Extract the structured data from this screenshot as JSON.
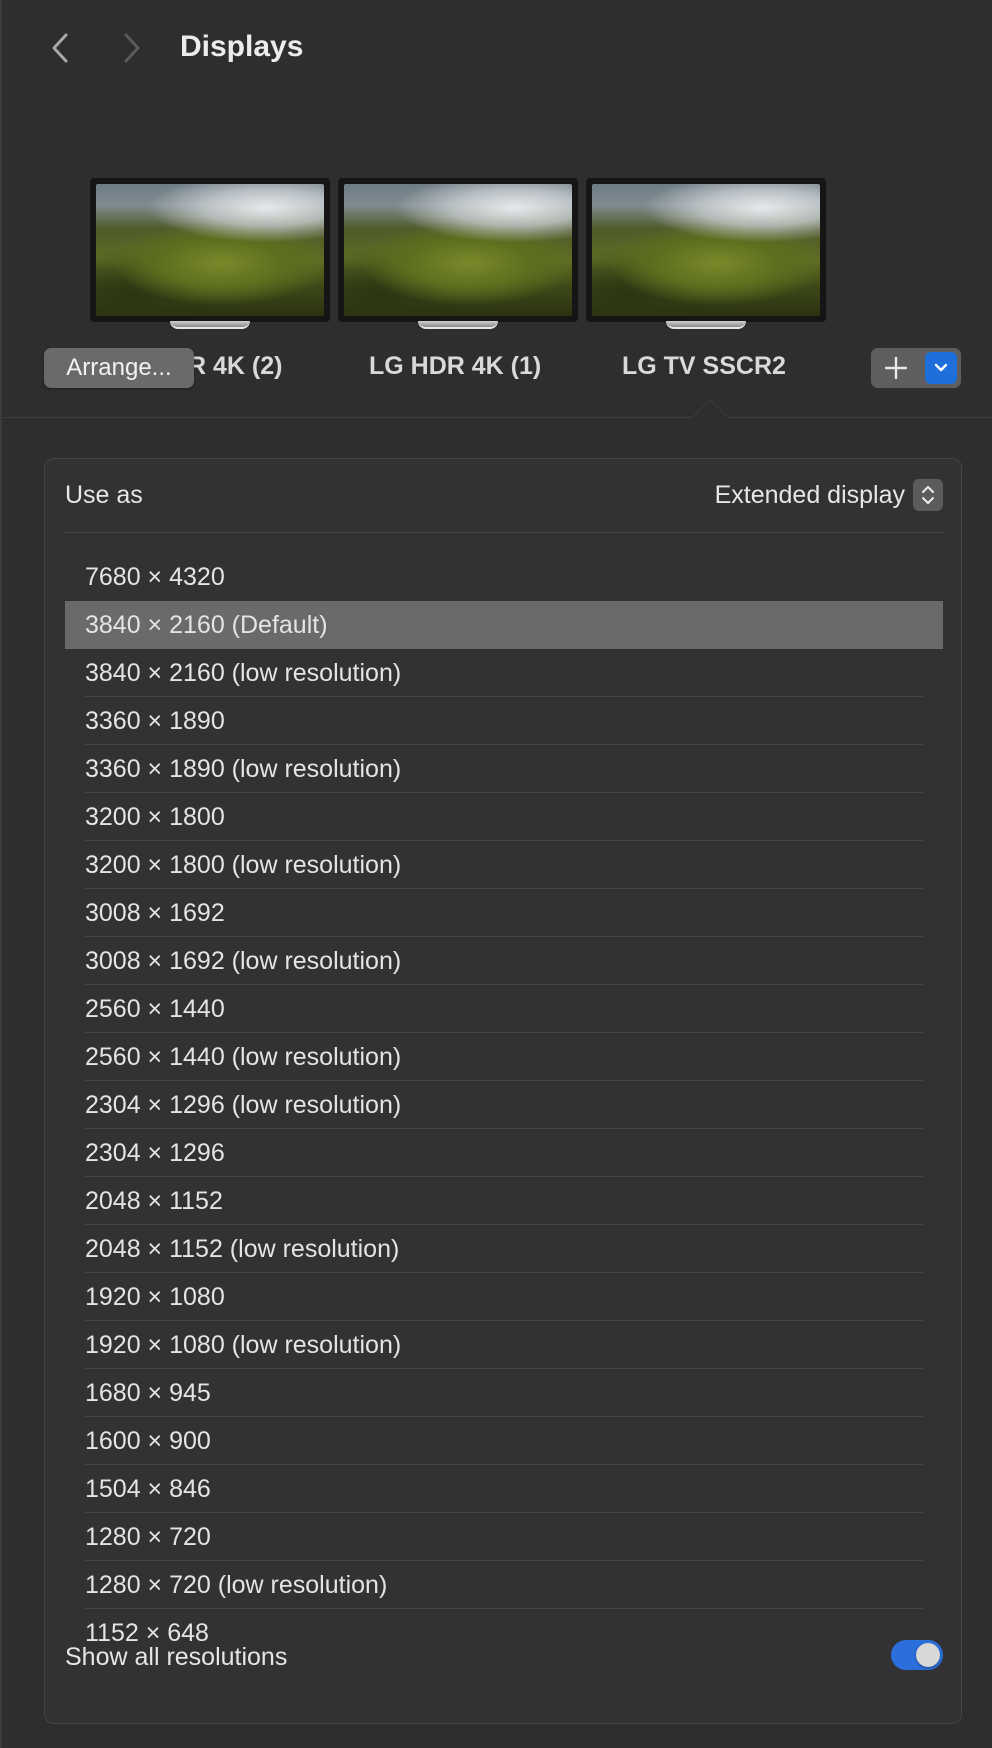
{
  "header": {
    "title": "Displays",
    "back_icon": "chevron-left-icon",
    "forward_icon": "chevron-right-icon"
  },
  "displays": [
    {
      "name": "LG HDR 4K (2)",
      "visible_label": "R 4K (2)"
    },
    {
      "name": "LG HDR 4K (1)",
      "visible_label": "LG HDR 4K (1)"
    },
    {
      "name": "LG TV SSCR2",
      "visible_label": "LG TV SSCR2",
      "selected": true
    }
  ],
  "arrange_label": "Arrange...",
  "add_display": {
    "icon": "plus-icon",
    "dropdown_icon": "chevron-down-icon",
    "accent": "#1e6fdc"
  },
  "settings": {
    "use_as_label": "Use as",
    "use_as_value": "Extended display",
    "resolutions": [
      "7680 × 4320",
      "3840 × 2160 (Default)",
      "3840 × 2160 (low resolution)",
      "3360 × 1890",
      "3360 × 1890 (low resolution)",
      "3200 × 1800",
      "3200 × 1800 (low resolution)",
      "3008 × 1692",
      "3008 × 1692 (low resolution)",
      "2560 × 1440",
      "2560 × 1440 (low resolution)",
      "2304 × 1296 (low resolution)",
      "2304 × 1296",
      "2048 × 1152",
      "2048 × 1152 (low resolution)",
      "1920 × 1080",
      "1920 × 1080 (low resolution)",
      "1680 × 945",
      "1600 × 900",
      "1504 × 846",
      "1280 × 720",
      "1280 × 720 (low resolution)",
      "1152 × 648"
    ],
    "selected_resolution": "3840 × 2160 (Default)",
    "show_all_label": "Show all resolutions",
    "show_all_enabled": true,
    "toggle_color": "#2a6fdb"
  }
}
